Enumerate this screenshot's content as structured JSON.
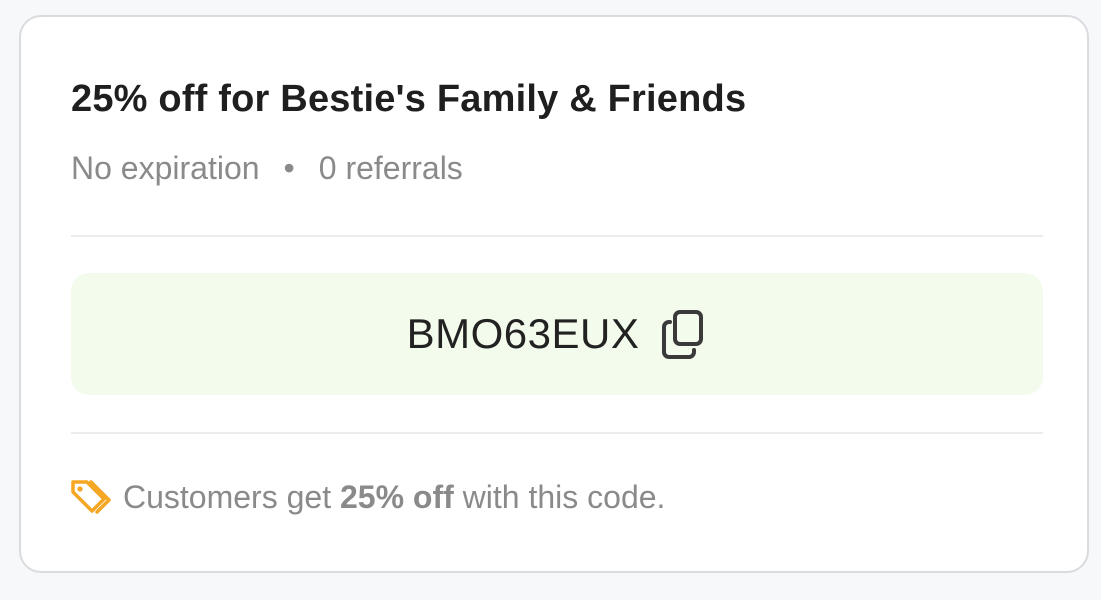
{
  "card": {
    "title": "25% off for Bestie's Family & Friends",
    "expiration": "No expiration",
    "separator": "•",
    "referrals": "0 referrals",
    "code": "BMO63EUX",
    "footer": {
      "prefix": "Customers get ",
      "highlight": "25% off",
      "suffix": " with this code."
    }
  },
  "icons": {
    "copy": "copy-icon",
    "tag": "tag-icon"
  },
  "colors": {
    "code_background": "#f3fcec",
    "tag_icon": "#f5a623",
    "muted_text": "#8a8a8a",
    "title_text": "#1f1f1f"
  }
}
